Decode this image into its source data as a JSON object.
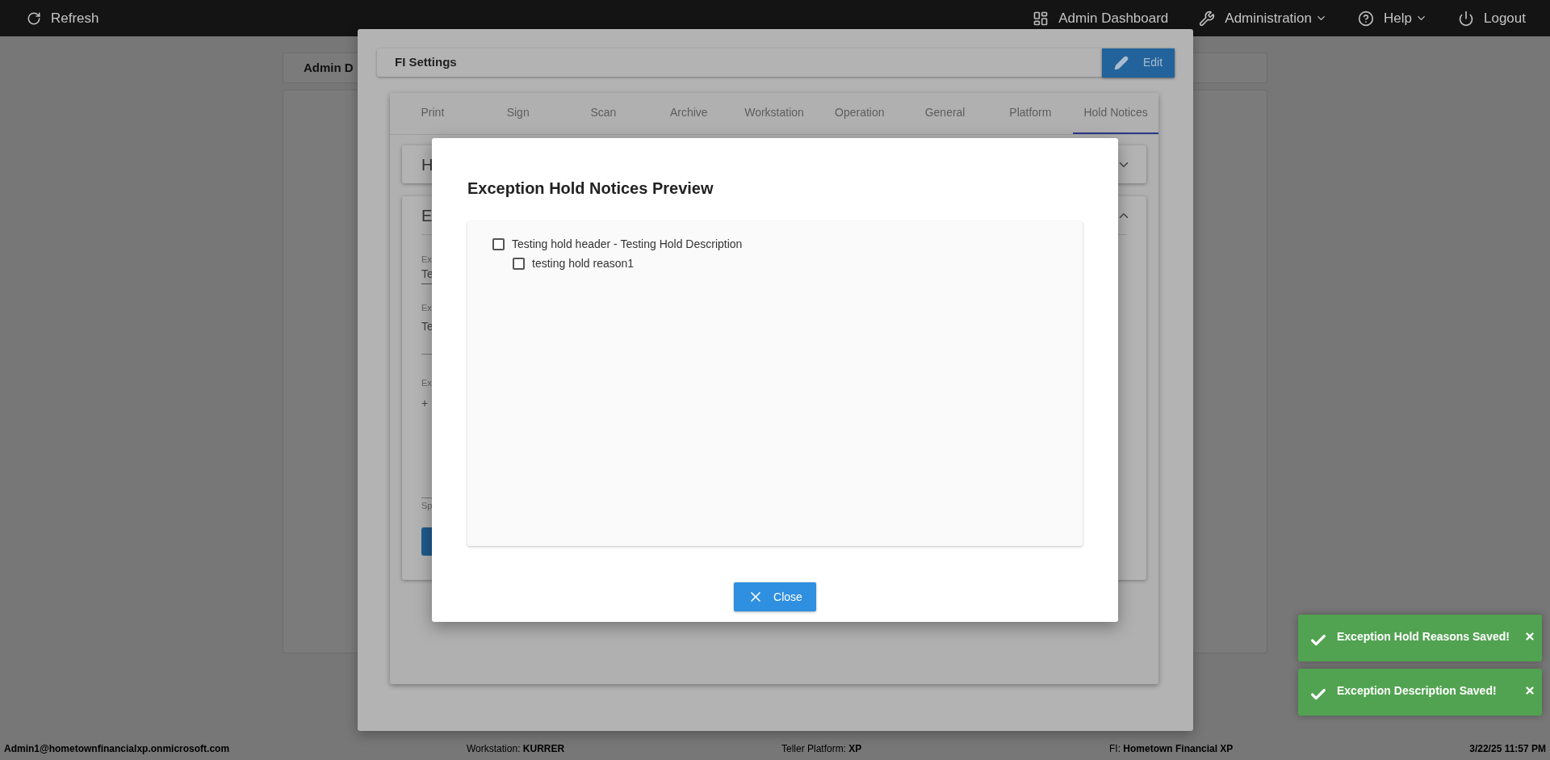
{
  "top_bar": {
    "refresh": "Refresh",
    "items": [
      {
        "kind": "dashboard",
        "label": "Admin Dashboard",
        "dropdown": false
      },
      {
        "kind": "wrench",
        "label": "Administration",
        "dropdown": true
      },
      {
        "kind": "help",
        "label": "Help",
        "dropdown": true
      },
      {
        "kind": "power",
        "label": "Logout",
        "dropdown": false
      }
    ]
  },
  "admin_card": {
    "title": "Admin D"
  },
  "fi_settings": {
    "title": "FI Settings",
    "edit_button": "Edit",
    "tabs": [
      {
        "label": "Print",
        "selected": false
      },
      {
        "label": "Sign",
        "selected": false
      },
      {
        "label": "Scan",
        "selected": false
      },
      {
        "label": "Archive",
        "selected": false
      },
      {
        "label": "Workstation",
        "selected": false
      },
      {
        "label": "Operation",
        "selected": false
      },
      {
        "label": "General",
        "selected": false
      },
      {
        "label": "Platform",
        "selected": false
      },
      {
        "label": "Hold Notices",
        "selected": true
      }
    ],
    "sections": [
      {
        "title": "H",
        "expanded": false
      },
      {
        "title": "E",
        "expanded": true,
        "fields": [
          {
            "kind": "field",
            "label": "Ex",
            "value": "Te"
          },
          {
            "kind": "area",
            "label": "Ex",
            "value": "Te"
          },
          {
            "kind": "list",
            "label": "Ex",
            "value": "+"
          },
          {
            "kind": "note",
            "label": "Sp"
          }
        ]
      }
    ]
  },
  "modal": {
    "title": "Exception Hold Notices Preview",
    "items": [
      {
        "label": "Testing hold header - Testing Hold Description",
        "checked": false,
        "children": [
          {
            "label": "testing hold reason1",
            "checked": false
          }
        ]
      }
    ],
    "close_button": "Close"
  },
  "toasts": [
    {
      "message": "Exception Hold Reasons Saved!"
    },
    {
      "message": "Exception Description Saved!"
    }
  ],
  "status_bar": {
    "user": "Admin1@hometownfinancialxp.onmicrosoft.com",
    "workstation": "Workstation: **KURRER**",
    "platform": "Teller Platform: **XP**",
    "fi": "FI: **Hometown Financial XP**",
    "datetime": "3/22/25 11:57 PM"
  }
}
